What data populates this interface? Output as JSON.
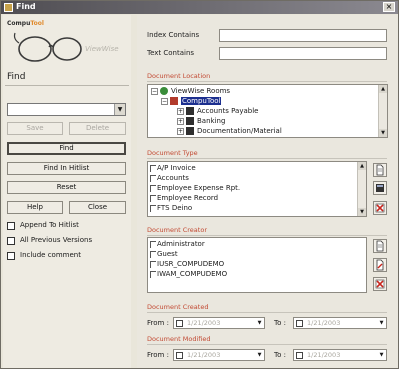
{
  "window": {
    "title": "Find",
    "close_glyph": "×"
  },
  "left": {
    "brand_prefix": "Compu",
    "brand_suffix": "Tool",
    "logo_script": "ViewWise",
    "find_label": "Find",
    "combo_value": "",
    "buttons": {
      "save": "Save",
      "delete": "Delete",
      "find": "Find",
      "find_in_hitlist": "Find In Hitlist",
      "reset": "Reset",
      "help": "Help",
      "close": "Close"
    },
    "checkboxes": [
      {
        "label": "Append To Hitlist",
        "checked": false
      },
      {
        "label": "All Previous Versions",
        "checked": false
      },
      {
        "label": "Include comment",
        "checked": false
      }
    ]
  },
  "right": {
    "index_contains_label": "Index Contains",
    "index_contains_value": "",
    "text_contains_label": "Text Contains",
    "text_contains_value": "",
    "document_location": {
      "heading": "Document Location",
      "tree": [
        {
          "label": "ViewWise Rooms",
          "expander": "−",
          "icon": "rooms-icon"
        },
        {
          "label": "CompuTool",
          "expander": "−",
          "icon": "house-icon",
          "selected": true
        },
        {
          "label": "Accounts Payable",
          "expander": "+",
          "icon": "folder-icon"
        },
        {
          "label": "Banking",
          "expander": "+",
          "icon": "folder-icon"
        },
        {
          "label": "Documentation/Material",
          "expander": "+",
          "icon": "folder-icon"
        }
      ]
    },
    "document_type": {
      "heading": "Document Type",
      "items": [
        "A/P Invoice",
        "Accounts",
        "Employee Expense Rpt.",
        "Employee Record",
        "FTS Deino"
      ]
    },
    "document_creator": {
      "heading": "Document Creator",
      "items": [
        "Administrator",
        "Guest",
        "IUSR_COMPUDEMO",
        "IWAM_COMPUDEMO"
      ]
    },
    "document_created": {
      "heading": "Document Created",
      "from_label": "From :",
      "to_label": "To :",
      "from_value": "1/21/2003",
      "to_value": "1/21/2003"
    },
    "document_modified": {
      "heading": "Document Modified",
      "from_label": "From :",
      "to_label": "To :",
      "from_value": "1/21/2003",
      "to_value": "1/21/2003"
    }
  },
  "icons": {
    "scroll_up": "▲",
    "scroll_down": "▼",
    "dropdown": "▼"
  }
}
